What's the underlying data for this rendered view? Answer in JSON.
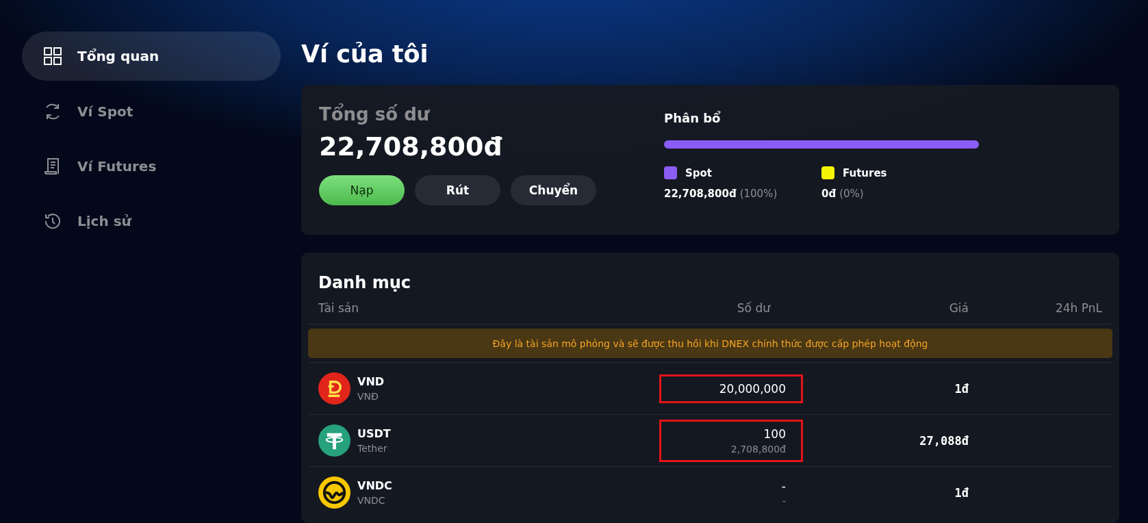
{
  "sidebar": {
    "items": [
      {
        "label": "Tổng quan",
        "selected": true
      },
      {
        "label": "Ví Spot",
        "selected": false
      },
      {
        "label": "Ví Futures",
        "selected": false
      },
      {
        "label": "Lịch sử",
        "selected": false
      }
    ]
  },
  "page_title": "Ví của tôi",
  "summary": {
    "label": "Tổng số dư",
    "total": "22,708,800đ",
    "buttons": [
      {
        "label": "Nạp",
        "kind": "primary"
      },
      {
        "label": "Rút",
        "kind": "secondary"
      },
      {
        "label": "Chuyển",
        "kind": "secondary"
      }
    ],
    "allocation": {
      "title": "Phân bổ",
      "bar_segments": [
        {
          "level": 1,
          "color": "#8b5cf6"
        }
      ],
      "legend": [
        {
          "name": "Spot",
          "color": "#8b5cf6",
          "amount": "22,708,800đ",
          "percent": "(100%)"
        },
        {
          "name": "Futures",
          "color": "#f5f50a",
          "amount": "0đ",
          "percent": "(0%)"
        }
      ]
    }
  },
  "portfolio": {
    "title": "Danh mục",
    "columns": [
      "Tài sản",
      "Số dư",
      "Giá",
      "24h PnL"
    ],
    "notice": "Đây là tài sản mô phỏng và sẽ được thu hồi khi DNEX chính thức được cấp phép hoạt động",
    "rows": [
      {
        "symbol": "VND",
        "name": "VNĐ",
        "balance": "20,000,000",
        "highlighted": true,
        "price": "1đ"
      },
      {
        "symbol": "USDT",
        "name": "Tether",
        "balance": "100",
        "balance_value": "2,708,800đ",
        "highlighted": true,
        "price": "27,088đ"
      },
      {
        "symbol": "VNDC",
        "name": "VNDC",
        "balance": "-",
        "balance_value": "-",
        "highlighted": false,
        "price": "1đ"
      }
    ]
  }
}
